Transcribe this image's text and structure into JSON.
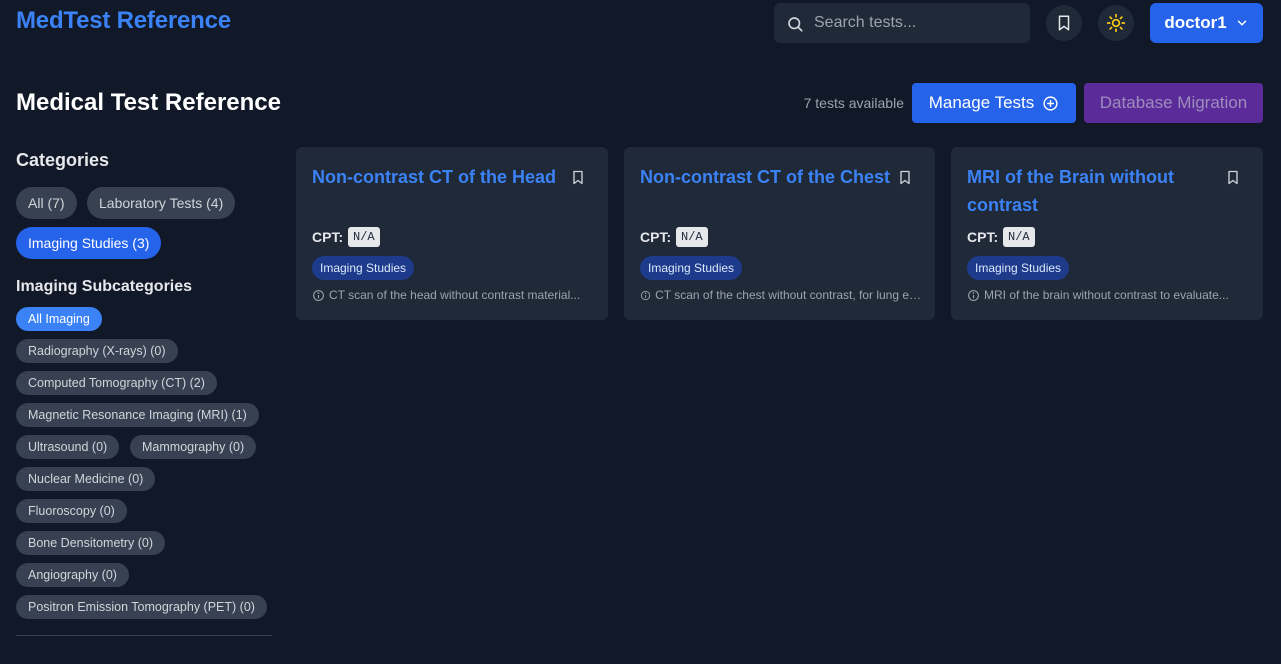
{
  "header": {
    "brand": "MedTest Reference",
    "search_placeholder": "Search tests...",
    "user_label": "doctor1"
  },
  "title_row": {
    "title": "Medical Test Reference",
    "count_text": "7 tests available",
    "manage_label": "Manage Tests",
    "migration_label": "Database Migration"
  },
  "sidebar": {
    "categories_heading": "Categories",
    "categories": [
      {
        "label": "All (7)"
      },
      {
        "label": "Laboratory Tests (4)"
      },
      {
        "label": "Imaging Studies (3)"
      }
    ],
    "subcategories_heading": "Imaging Subcategories",
    "subcategories": [
      {
        "label": "All Imaging"
      },
      {
        "label": "Radiography (X-rays) (0)"
      },
      {
        "label": "Computed Tomography (CT) (2)"
      },
      {
        "label": "Magnetic Resonance Imaging (MRI) (1)"
      },
      {
        "label": "Ultrasound (0)"
      },
      {
        "label": "Mammography (0)"
      },
      {
        "label": "Nuclear Medicine (0)"
      },
      {
        "label": "Fluoroscopy (0)"
      },
      {
        "label": "Bone Densitometry (0)"
      },
      {
        "label": "Angiography (0)"
      },
      {
        "label": "Positron Emission Tomography (PET) (0)"
      }
    ]
  },
  "cards": [
    {
      "title": "Non-contrast CT of the Head",
      "cpt_label": "CPT:",
      "cpt_code": "N/A",
      "tag": "Imaging Studies",
      "description": "CT scan of the head without contrast material..."
    },
    {
      "title": "Non-contrast CT of the Chest",
      "cpt_label": "CPT:",
      "cpt_code": "N/A",
      "tag": "Imaging Studies",
      "description": "CT scan of the chest without contrast, for lung evaluation..."
    },
    {
      "title": "MRI of the Brain without contrast",
      "cpt_label": "CPT:",
      "cpt_code": "N/A",
      "tag": "Imaging Studies",
      "description": "MRI of the brain without contrast to evaluate..."
    }
  ],
  "colors": {
    "background": "#111827",
    "surface": "#1f2937",
    "accent": "#2563eb",
    "accent_text": "#3b82f6",
    "migration": "#5b2b9a"
  },
  "icons": {
    "search": "search-icon",
    "bookmark": "bookmark-icon",
    "theme": "sun-icon",
    "chevron": "chevron-down-icon",
    "add": "plus-circle-icon",
    "info": "info-icon"
  }
}
